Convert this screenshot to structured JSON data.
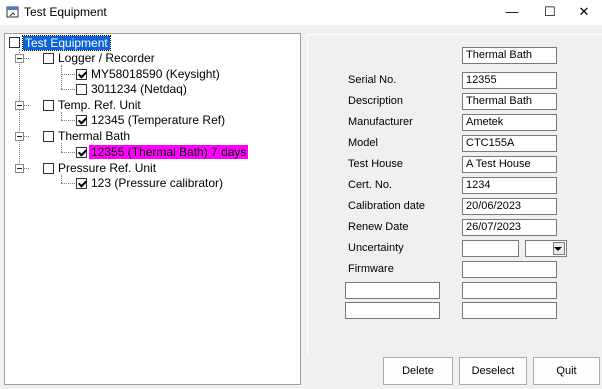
{
  "window": {
    "title": "Test Equipment",
    "minimize": "—",
    "maximize": "☐",
    "close": "✕"
  },
  "tree": {
    "root": "Test Equipment",
    "groups": [
      {
        "label": "Logger / Recorder",
        "children": [
          {
            "label": "MY58018590 (Keysight)",
            "checked": true
          },
          {
            "label": "3011234 (Netdaq)",
            "checked": false
          }
        ]
      },
      {
        "label": "Temp. Ref. Unit",
        "children": [
          {
            "label": "12345 (Temperature Ref)",
            "checked": true
          }
        ]
      },
      {
        "label": "Thermal Bath",
        "children": [
          {
            "label": "12355 (Thermal Bath) 7 days",
            "checked": true,
            "highlight": "#ff00ff"
          }
        ]
      },
      {
        "label": "Pressure Ref. Unit",
        "children": [
          {
            "label": "123 (Pressure calibrator)",
            "checked": true
          }
        ]
      }
    ]
  },
  "details": {
    "header_value": "Thermal Bath",
    "fields": [
      {
        "label": "Serial No.",
        "value": "12355"
      },
      {
        "label": "Description",
        "value": "Thermal Bath"
      },
      {
        "label": "Manufacturer",
        "value": "Ametek"
      },
      {
        "label": "Model",
        "value": "CTC155A"
      },
      {
        "label": "Test House",
        "value": "A Test House"
      },
      {
        "label": "Cert. No.",
        "value": "1234"
      },
      {
        "label": "Calibration date",
        "value": "20/06/2023"
      },
      {
        "label": "Renew Date",
        "value": "26/07/2023"
      }
    ],
    "uncertainty_label": "Uncertainty",
    "uncertainty_value": "",
    "uncertainty_unit": "",
    "firmware_label": "Firmware",
    "firmware_value": "",
    "extra_rows": [
      "",
      ""
    ]
  },
  "buttons": {
    "delete": "Delete",
    "deselect": "Deselect",
    "quit": "Quit"
  },
  "colors": {
    "selection": "#0a64d8",
    "highlight": "#ff00ff"
  }
}
